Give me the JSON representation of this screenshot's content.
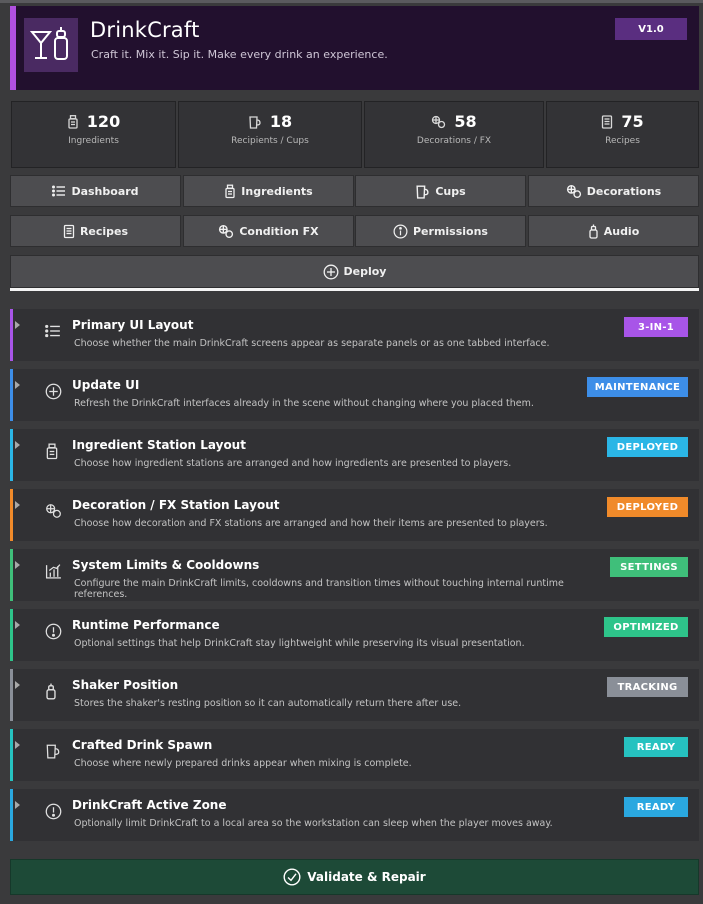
{
  "header": {
    "title": "DrinkCraft",
    "subtitle": "Craft it. Mix it. Sip it. Make every drink an experience.",
    "version": "V1.0",
    "accent": "#b050e0"
  },
  "stats": [
    {
      "value": "120",
      "label": "Ingredients",
      "icon": "bottle-icon"
    },
    {
      "value": "18",
      "label": "Recipients / Cups",
      "icon": "cup-icon"
    },
    {
      "value": "58",
      "label": "Decorations / FX",
      "icon": "decoration-icon"
    },
    {
      "value": "75",
      "label": "Recipes",
      "icon": "recipe-icon"
    }
  ],
  "nav": {
    "row1": [
      {
        "label": "Dashboard",
        "icon": "list-icon"
      },
      {
        "label": "Ingredients",
        "icon": "bottle-icon"
      },
      {
        "label": "Cups",
        "icon": "cup-icon"
      },
      {
        "label": "Decorations",
        "icon": "decoration-icon"
      }
    ],
    "row2": [
      {
        "label": "Recipes",
        "icon": "recipe-icon"
      },
      {
        "label": "Condition FX",
        "icon": "decoration-icon"
      },
      {
        "label": "Permissions",
        "icon": "info-icon"
      },
      {
        "label": "Audio",
        "icon": "shaker-icon"
      }
    ],
    "deploy": {
      "label": "Deploy",
      "icon": "plus-circle-icon"
    }
  },
  "rows": [
    {
      "title": "Primary UI Layout",
      "desc": "Choose whether the main DrinkCraft screens appear as separate panels or as one tabbed interface.",
      "badge": "3-IN-1",
      "badge_color": "#a855e8",
      "border_color": "#a855e8",
      "icon": "list-icon"
    },
    {
      "title": "Update UI",
      "desc": "Refresh the DrinkCraft interfaces already in the scene without changing where you placed them.",
      "badge": "MAINTENANCE",
      "badge_color": "#3d8ee8",
      "border_color": "#3d8ee8",
      "icon": "plus-circle-icon"
    },
    {
      "title": "Ingredient Station Layout",
      "desc": "Choose how ingredient stations are arranged and how ingredients are presented to players.",
      "badge": "DEPLOYED",
      "badge_color": "#2bb6e6",
      "border_color": "#2bb6e6",
      "icon": "bottle-icon"
    },
    {
      "title": "Decoration / FX Station Layout",
      "desc": "Choose how decoration and FX stations are arranged and how their items are presented to players.",
      "badge": "DEPLOYED",
      "badge_color": "#f08a2a",
      "border_color": "#f08a2a",
      "icon": "decoration-icon"
    },
    {
      "title": "System Limits & Cooldowns",
      "desc": "Configure the main DrinkCraft limits, cooldowns and transition times without touching internal runtime references.",
      "badge": "SETTINGS",
      "badge_color": "#3fbf7a",
      "border_color": "#3fbf7a",
      "icon": "chart-icon"
    },
    {
      "title": "Runtime Performance",
      "desc": "Optional settings that help DrinkCraft stay lightweight while preserving its visual presentation.",
      "badge": "OPTIMIZED",
      "badge_color": "#2ec48a",
      "border_color": "#2ec48a",
      "icon": "alert-icon"
    },
    {
      "title": "Shaker Position",
      "desc": "Stores the shaker's resting position so it can automatically return there after use.",
      "badge": "TRACKING",
      "badge_color": "#8a8f98",
      "border_color": "#8a8f98",
      "icon": "shaker-icon"
    },
    {
      "title": "Crafted Drink Spawn",
      "desc": "Choose where newly prepared drinks appear when mixing is complete.",
      "badge": "READY",
      "badge_color": "#26c2c0",
      "border_color": "#26c2c0",
      "icon": "cup-icon"
    },
    {
      "title": "DrinkCraft Active Zone",
      "desc": "Optionally limit DrinkCraft to a local area so the workstation can sleep when the player moves away.",
      "badge": "READY",
      "badge_color": "#2aa8e0",
      "border_color": "#2aa8e0",
      "icon": "alert-icon"
    }
  ],
  "validate": {
    "label": "Validate & Repair",
    "icon": "check-circle-icon"
  }
}
